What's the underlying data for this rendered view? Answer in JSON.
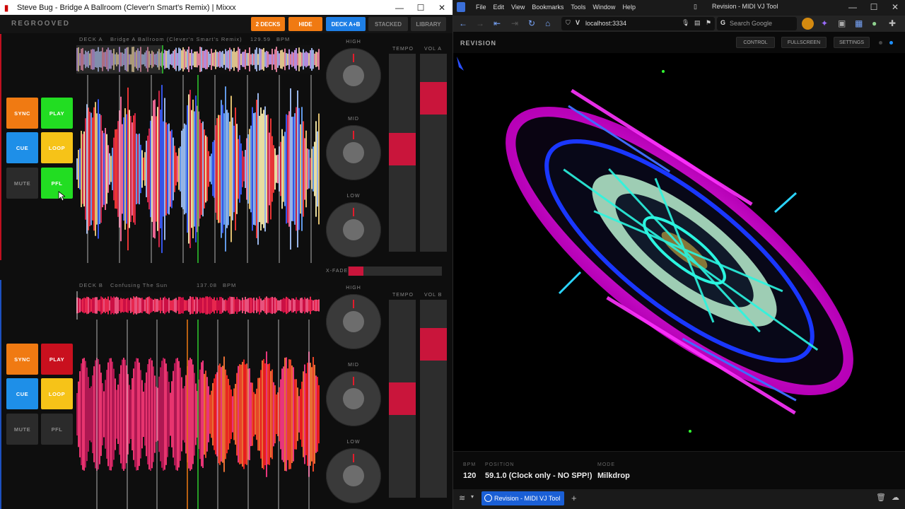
{
  "mixxx": {
    "window_title": "Steve Bug - Bridge A Ballroom (Clever'n Smart's Remix) | Mixxx",
    "brand": "REGROOVED",
    "toolbar": {
      "two_decks": "2 DECKS",
      "hide": "HIDE",
      "deck_ab": "DECK A+B",
      "stacked": "STACKED",
      "library": "LIBRARY"
    },
    "deck_a": {
      "label": "DECK A",
      "track": "Bridge A Ballroom (Clever'n Smart's Remix)",
      "bpm_value": "129.59",
      "bpm_unit": "BPM",
      "pads": {
        "sync": "SYNC",
        "play": "PLAY",
        "cue": "CUE",
        "loop": "LOOP",
        "mute": "MUTE",
        "pfl": "PFL"
      },
      "eq": {
        "high": "HIGH",
        "mid": "MID",
        "low": "LOW"
      },
      "tempo_label": "TEMPO",
      "vol_label": "VOL A",
      "tempo_position": 0.52,
      "volume_level": 0.83
    },
    "deck_b": {
      "label": "DECK B",
      "track": "Confusing The Sun",
      "bpm_value": "137.08",
      "bpm_unit": "BPM",
      "pads": {
        "sync": "SYNC",
        "play": "PLAY",
        "cue": "CUE",
        "loop": "LOOP",
        "mute": "MUTE",
        "pfl": "PFL"
      },
      "eq": {
        "high": "HIGH",
        "mid": "MID",
        "low": "LOW"
      },
      "tempo_label": "TEMPO",
      "vol_label": "VOL B",
      "tempo_position": 0.5,
      "volume_level": 0.83
    },
    "crossfader_label": "X-FADE",
    "crossfader_position": 0.0
  },
  "browser": {
    "window_title": "Revision - MIDI VJ Tool",
    "menu": [
      "File",
      "Edit",
      "View",
      "Bookmarks",
      "Tools",
      "Window",
      "Help"
    ],
    "url": "localhost:3334",
    "search_placeholder": "Search Google",
    "app_title": "REVISION",
    "buttons": {
      "control": "CONTROL",
      "fullscreen": "FULLSCREEN",
      "settings": "SETTINGS"
    },
    "status": {
      "bpm_label": "BPM",
      "bpm_value": "120",
      "position_label": "POSITION",
      "position_value": "59.1.0 (Clock only - NO SPP!)",
      "mode_label": "MODE",
      "mode_value": "Milkdrop"
    },
    "tab_label": "Revision - MIDI VJ Tool"
  },
  "colors": {
    "orange": "#f07a12",
    "green": "#22dd22",
    "blue": "#1e8fe8",
    "yellow": "#f6c318",
    "red": "#c9101e",
    "accent": "#1a5fd6"
  }
}
